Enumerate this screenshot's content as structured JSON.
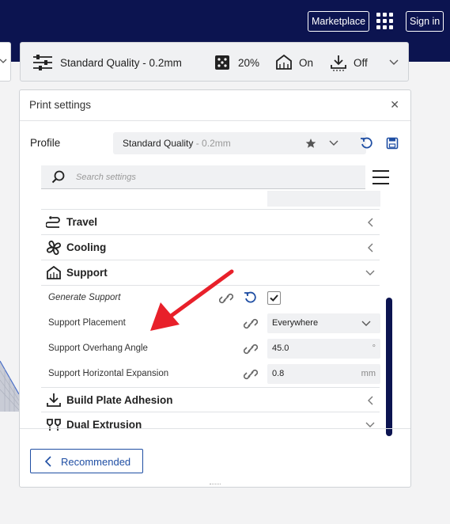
{
  "header": {
    "marketplace_label": "Marketplace",
    "signin_label": "Sign in"
  },
  "quality_bar": {
    "profile": "Standard Quality - 0.2mm",
    "infill": "20%",
    "support": "On",
    "adhesion": "Off"
  },
  "panel": {
    "title": "Print settings",
    "profile_label": "Profile",
    "profile_name": "Standard Quality",
    "profile_suffix": " - 0.2mm",
    "search_placeholder": "Search settings",
    "categories": {
      "travel": "Travel",
      "cooling": "Cooling",
      "support": "Support",
      "build_plate": "Build Plate Adhesion",
      "dual_extrusion": "Dual Extrusion"
    },
    "settings": {
      "generate_support": {
        "label": "Generate Support",
        "checked": true
      },
      "placement": {
        "label": "Support Placement",
        "value": "Everywhere"
      },
      "overhang": {
        "label": "Support Overhang Angle",
        "value": "45.0",
        "unit": "°"
      },
      "expansion": {
        "label": "Support Horizontal Expansion",
        "value": "0.8",
        "unit": "mm"
      }
    },
    "recommended_label": "Recommended"
  },
  "colors": {
    "header_bg": "#0c1450",
    "accent_blue": "#1f4ea3",
    "arrow_red": "#e8202a"
  }
}
